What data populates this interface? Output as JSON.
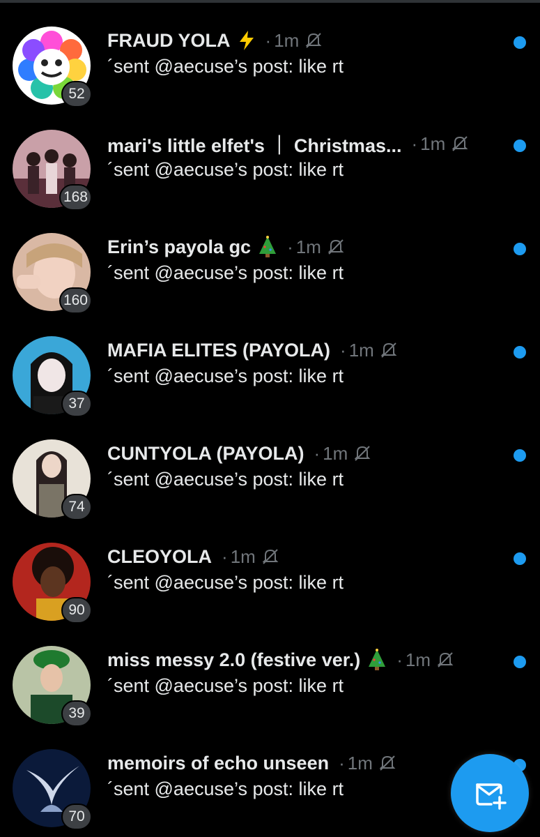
{
  "colors": {
    "background": "#000000",
    "accent": "#1d9bf0",
    "text_primary": "#e7e9ea",
    "text_secondary": "#71767b",
    "badge_bg": "#3d4044"
  },
  "chats": [
    {
      "name": "FRAUD YOLA",
      "emoji": "⚡",
      "time": "1m",
      "preview": "´sent @aecuse’s post: like rt",
      "count": "52",
      "unread": true
    },
    {
      "name": "mari's little elfet's ｜ Christmas...",
      "emoji": "",
      "time": "1m",
      "preview": "´sent @aecuse’s post: like rt",
      "count": "168",
      "unread": true
    },
    {
      "name": "Erin’s payola gc",
      "emoji": "🎄",
      "time": "1m",
      "preview": "´sent @aecuse’s post: like rt",
      "count": "160",
      "unread": true
    },
    {
      "name": "MAFIA ELITES (PAYOLA)",
      "emoji": "",
      "time": "1m",
      "preview": "´sent @aecuse’s post: like rt",
      "count": "37",
      "unread": true
    },
    {
      "name": "CUNTYOLA (PAYOLA)",
      "emoji": "",
      "time": "1m",
      "preview": "´sent @aecuse’s post: like rt",
      "count": "74",
      "unread": true
    },
    {
      "name": "CLEOYOLA",
      "emoji": "",
      "time": "1m",
      "preview": "´sent @aecuse’s post: like rt",
      "count": "90",
      "unread": true
    },
    {
      "name": "miss messy 2.0  (festive ver.)",
      "emoji": "🎄",
      "time": "1m",
      "preview": "´sent @aecuse’s post: like rt",
      "count": "39",
      "unread": true
    },
    {
      "name": "memoirs of echo unseen",
      "emoji": "",
      "time": "1m",
      "preview": "´sent @aecuse’s post: like rt",
      "count": "70",
      "unread": true
    }
  ],
  "icons": {
    "mute": "bell-slash-icon",
    "compose": "new-message-icon"
  }
}
